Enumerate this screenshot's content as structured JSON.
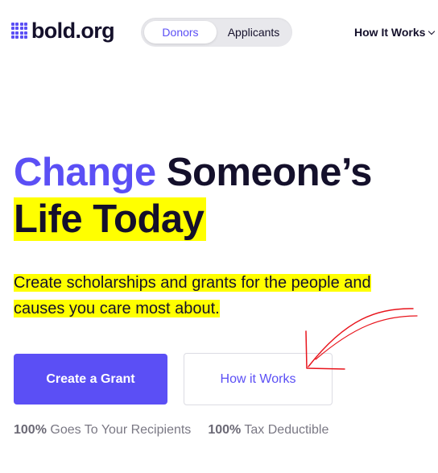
{
  "header": {
    "logo_text": "bold.org",
    "toggle": {
      "donors_label": "Donors",
      "applicants_label": "Applicants",
      "selected": "Donors"
    },
    "nav_how_it_works": "How It Works"
  },
  "hero": {
    "headline_accent": "Change",
    "headline_rest": "Someone’s",
    "headline_line2": "Life Today",
    "subtext_line1": "Create scholarships and grants for the people and",
    "subtext_line2": "causes you care most about.",
    "primary_button": "Create a Grant",
    "secondary_button": "How it Works"
  },
  "stats": [
    {
      "value": "100%",
      "label": "Goes To Your Recipients"
    },
    {
      "value": "100%",
      "label": "Tax Deductible"
    }
  ],
  "colors": {
    "accent": "#5b4ff5",
    "highlight": "#ffff00",
    "text": "#14102b",
    "annotation": "#e8141c"
  }
}
